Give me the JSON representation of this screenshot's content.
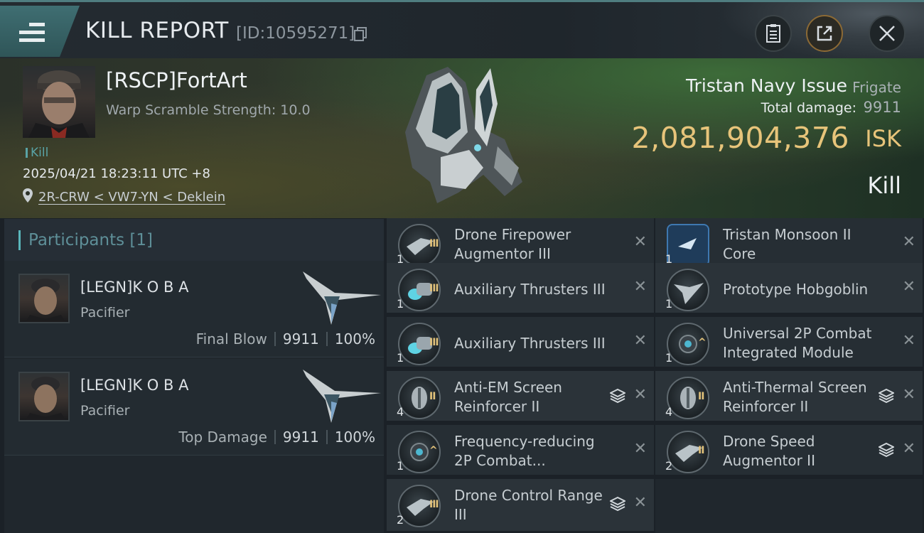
{
  "header": {
    "title": "KILL REPORT",
    "report_id": "[ID:10595271]",
    "menu_icon": "hamburger-icon",
    "buttons": [
      "clipboard-icon",
      "share-icon",
      "close-icon"
    ]
  },
  "victim": {
    "pilot_name": "[RSCP]FortArt",
    "warp_scramble": "Warp Scramble Strength: 10.0",
    "kill_tag": "Kill",
    "timestamp": "2025/04/21 18:23:11 UTC +8",
    "location": "2R-CRW < VW7-YN < Deklein",
    "ship_name": "Tristan Navy Issue",
    "ship_class": "Frigate",
    "total_damage_label": "Total damage:",
    "total_damage_value": "9911",
    "isk_value": "2,081,904,376",
    "isk_unit": "ISK",
    "result": "Kill"
  },
  "participants": {
    "label": "Participants",
    "count": "[1]",
    "list": [
      {
        "name": "[LEGN]K O B A",
        "ship": "Pacifier",
        "role": "Final Blow",
        "damage": "9911",
        "percent": "100%"
      },
      {
        "name": "[LEGN]K O B A",
        "ship": "Pacifier",
        "role": "Top Damage",
        "damage": "9911",
        "percent": "100%"
      }
    ]
  },
  "items_left": [
    {
      "qty": "1",
      "name1": "Drone Firepower",
      "name2": "Augmentor III",
      "tier": "III",
      "stack": false
    },
    {
      "qty": "1",
      "name1": "Auxiliary Thrusters III",
      "name2": "",
      "tier": "III",
      "stack": false
    },
    {
      "qty": "1",
      "name1": "Auxiliary Thrusters III",
      "name2": "",
      "tier": "III",
      "stack": false
    },
    {
      "qty": "4",
      "name1": "Anti-EM Screen",
      "name2": "Reinforcer II",
      "tier": "II",
      "stack": true
    },
    {
      "qty": "1",
      "name1": "Frequency-reducing",
      "name2": "2P Combat...",
      "tier": "^",
      "stack": false
    },
    {
      "qty": "2",
      "name1": "Drone Control Range",
      "name2": "III",
      "tier": "III",
      "stack": true
    }
  ],
  "items_right": [
    {
      "qty": "1",
      "name1": "Tristan Monsoon II",
      "name2": "Core",
      "tier": "",
      "stack": false
    },
    {
      "qty": "1",
      "name1": "Prototype  Hobgoblin",
      "name2": "",
      "tier": "",
      "stack": false
    },
    {
      "qty": "1",
      "name1": "Universal 2P Combat",
      "name2": "Integrated Module",
      "tier": "^",
      "stack": false
    },
    {
      "qty": "4",
      "name1": "Anti-Thermal Screen",
      "name2": "Reinforcer II",
      "tier": "II",
      "stack": true
    },
    {
      "qty": "2",
      "name1": "Drone Speed",
      "name2": "Augmentor II",
      "tier": "II",
      "stack": true
    }
  ]
}
